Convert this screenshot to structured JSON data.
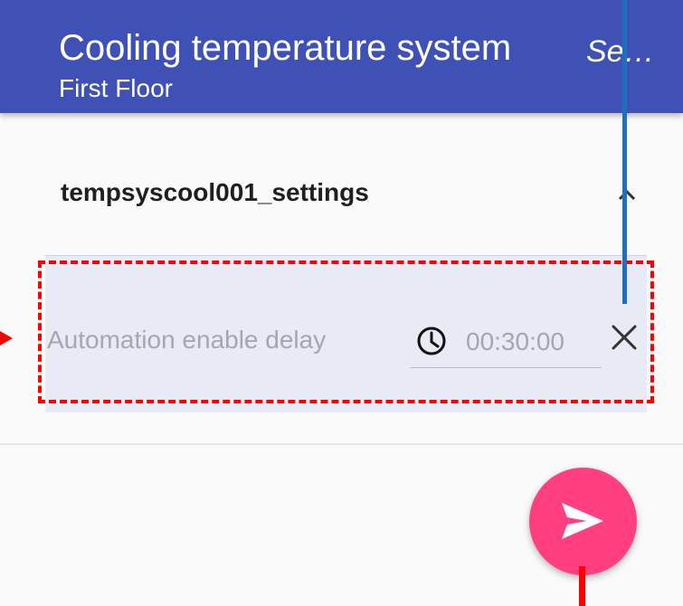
{
  "header": {
    "title": "Cooling temperature system",
    "subtitle": "First Floor",
    "action_label": "Se…"
  },
  "section": {
    "title": "tempsyscool001_settings",
    "collapse_icon": "chevron-up-icon"
  },
  "setting": {
    "label": "Automation enable delay",
    "value": "00:30:00",
    "clock_icon": "clock-icon",
    "clear_icon": "close-icon"
  },
  "fab": {
    "icon": "send-icon"
  },
  "colors": {
    "primary": "#3f51b5",
    "panel": "#e8eaf6",
    "accent": "#ff3f7f",
    "annotation_red": "#ff0000",
    "annotation_blue": "#1f6fbf"
  }
}
